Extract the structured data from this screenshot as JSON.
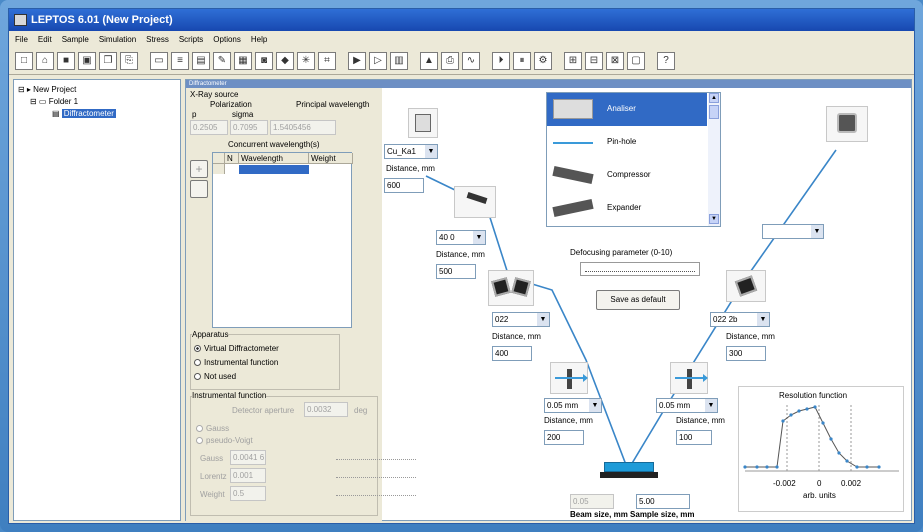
{
  "window": {
    "title": "LEPTOS 6.01 (New Project)"
  },
  "menu": [
    "File",
    "Edit",
    "Sample",
    "Simulation",
    "Stress",
    "Scripts",
    "Options",
    "Help"
  ],
  "toolbar_icons": [
    "new-icon",
    "open-icon",
    "save-icon",
    "save-all-icon",
    "copy-icon",
    "paste-icon",
    "folder-icon",
    "document-icon",
    "calculator-icon",
    "edit-icon",
    "table-icon",
    "preview-icon",
    "cube-icon",
    "star-icon",
    "fit-icon",
    "run-icon",
    "stop-icon",
    "graph-icon",
    "chart-icon",
    "print-icon",
    "wave-icon",
    "play-icon",
    "pause-icon",
    "settings-icon",
    "layout1-icon",
    "layout2-icon",
    "layout3-icon",
    "window-icon",
    "help-icon"
  ],
  "tree": {
    "root": "New Project",
    "folder": "Folder 1",
    "item": "Diffractometer"
  },
  "doc_title": "Diffractometer",
  "xray": {
    "header": "X-Ray source",
    "polarization_label": "Polarization",
    "p_label": "p",
    "sigma_label": "sigma",
    "principal_label": "Principal wavelength",
    "p_value": "0.2505",
    "sigma_value": "0.7095",
    "wavelength_value": "1.5405456",
    "concurrent_label": "Concurrent wavelength(s)",
    "col_n": "N",
    "col_wavelength": "Wavelength",
    "col_weight": "Weight"
  },
  "apparatus": {
    "header": "Apparatus",
    "options": [
      "Virtual Diffractometer",
      "Instrumental function",
      "Not used"
    ],
    "selected": 0
  },
  "instrumental": {
    "header": "Instrumental function",
    "detector_label": "Detector aperture",
    "detector_value": "0.0032",
    "unit": "deg",
    "radio1": "Gauss",
    "radio2": "pseudo-Voigt",
    "gauss_label": "Gauss",
    "gauss_value": "0.0041 6",
    "lorentz_label": "Lorentz",
    "lorentz_value": "0.001",
    "weight_label": "Weight",
    "weight_value": "0.5"
  },
  "source": {
    "select": "Cu_Ka1",
    "distance_label": "Distance, mm",
    "distance_value": "600"
  },
  "mono": {
    "select": "40 0",
    "distance_label": "Distance, mm",
    "distance_value": "500"
  },
  "crystal_left": {
    "select": "022",
    "distance_label": "Distance, mm",
    "distance_value": "400"
  },
  "slit_left": {
    "select": "0.05 mm",
    "distance_label": "Distance, mm",
    "distance_value": "200"
  },
  "slit_right": {
    "select": "0.05 mm",
    "distance_label": "Distance, mm",
    "distance_value": "100"
  },
  "crystal_right": {
    "select": "022 2b",
    "distance_label": "Distance, mm",
    "distance_value": "300"
  },
  "options_list": {
    "items": [
      "Analiser",
      "Pin-hole",
      "Compressor",
      "Expander"
    ],
    "selected": 0
  },
  "defocusing": {
    "label": "Defocusing parameter (0-10)",
    "save_button": "Save as default"
  },
  "beam": {
    "beam_value": "0.05",
    "sample_value": "5.00",
    "label": "Beam size, mm  Sample size, mm"
  },
  "resolution": {
    "title": "Resolution function",
    "ticks": [
      "-0.002",
      "0",
      "0.002"
    ],
    "xlabel": "arb. units"
  }
}
